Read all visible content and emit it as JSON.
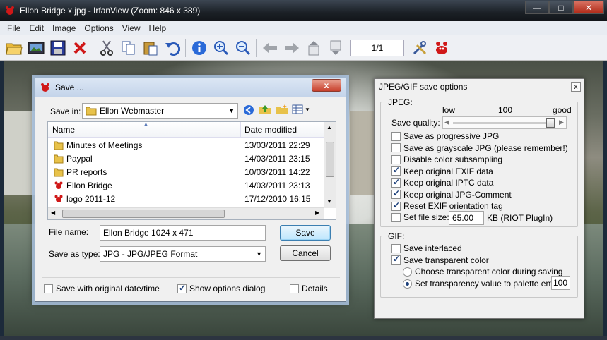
{
  "window": {
    "title": "Ellon Bridge x.jpg - IrfanView (Zoom: 846 x 389)",
    "minimize_glyph": "—",
    "maximize_glyph": "□",
    "close_glyph": "✕"
  },
  "menu": [
    "File",
    "Edit",
    "Image",
    "Options",
    "View",
    "Help"
  ],
  "toolbar": {
    "buttons": [
      "open-folder",
      "slideshow",
      "save",
      "delete",
      "cut",
      "copy",
      "paste",
      "undo",
      "info",
      "zoom-in",
      "zoom-out",
      "previous",
      "next",
      "first",
      "last",
      "settings",
      "irfanview"
    ],
    "page_indicator": "1/1"
  },
  "save_dialog": {
    "title": "Save ...",
    "close_glyph": "x",
    "save_in_label": "Save in:",
    "save_in_value": "Ellon Webmaster",
    "columns": {
      "name": "Name",
      "date": "Date modified"
    },
    "files": [
      {
        "name": "Minutes of Meetings",
        "date": "13/03/2011 22:29",
        "icon": "folder"
      },
      {
        "name": "Paypal",
        "date": "14/03/2011 23:15",
        "icon": "folder"
      },
      {
        "name": "PR reports",
        "date": "10/03/2011 14:22",
        "icon": "folder"
      },
      {
        "name": "Ellon Bridge",
        "date": "14/03/2011 23:13",
        "icon": "irfanview"
      },
      {
        "name": "logo 2011-12",
        "date": "17/12/2010 16:15",
        "icon": "irfanview"
      }
    ],
    "file_name_label": "File name:",
    "file_name_value": "Ellon Bridge 1024 x 471",
    "save_as_type_label": "Save as type:",
    "save_as_type_value": "JPG - JPG/JPEG Format",
    "save_button": "Save",
    "cancel_button": "Cancel",
    "options": [
      {
        "label": "Save with original date/time",
        "checked": false
      },
      {
        "label": "Show options dialog",
        "checked": true
      },
      {
        "label": "Details",
        "checked": false
      }
    ]
  },
  "options_panel": {
    "title": "JPEG/GIF save options",
    "close_glyph": "x",
    "jpeg_group": "JPEG:",
    "quality_low": "low",
    "quality_value": "100",
    "quality_good": "good",
    "quality_label": "Save quality:",
    "quality_level_fraction": 1.0,
    "jpeg_options": [
      {
        "label": "Save as progressive JPG",
        "checked": false
      },
      {
        "label": "Save as grayscale JPG (please remember!)",
        "checked": false
      },
      {
        "label": "Disable color subsampling",
        "checked": false
      },
      {
        "label": "Keep original EXIF data",
        "checked": true
      },
      {
        "label": "Keep original IPTC data",
        "checked": true
      },
      {
        "label": "Keep original JPG-Comment",
        "checked": true
      },
      {
        "label": "Reset EXIF orientation tag",
        "checked": true
      }
    ],
    "file_size_label": "Set file size:",
    "file_size_checked": false,
    "file_size_value": "65.00",
    "file_size_unit": "KB (RIOT PlugIn)",
    "gif_group": "GIF:",
    "gif_options": [
      {
        "label": "Save interlaced",
        "checked": false
      },
      {
        "label": "Save transparent color",
        "checked": true
      }
    ],
    "radio_options": [
      {
        "label": "Choose transparent color during saving",
        "selected": false
      },
      {
        "label": "Set transparency value to palette entry:",
        "selected": true
      }
    ],
    "palette_entry_value": "100"
  },
  "colors": {
    "accent": "#1c3f7a",
    "folder": "#e8c24a",
    "irfanview_red": "#d01818"
  }
}
